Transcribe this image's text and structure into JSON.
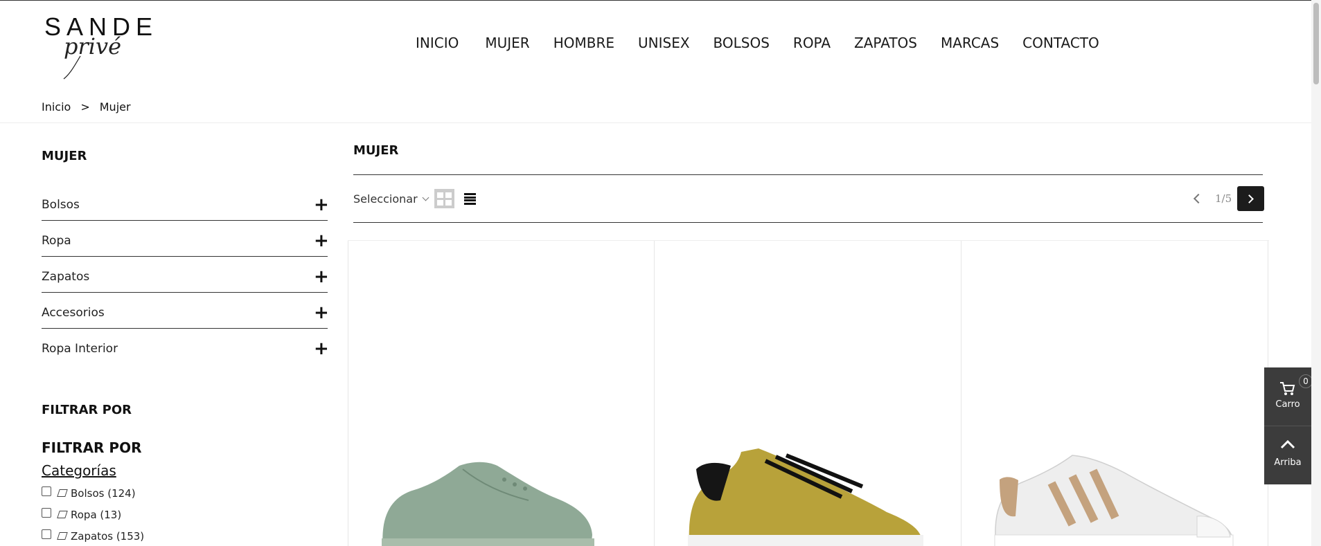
{
  "logo": {
    "word": "SANDE",
    "script": "privé"
  },
  "nav": [
    "INICIO",
    "MUJER",
    "HOMBRE",
    "UNISEX",
    "BOLSOS",
    "ROPA",
    "ZAPATOS",
    "MARCAS",
    "CONTACTO"
  ],
  "breadcrumb": {
    "home": "Inicio",
    "separator": ">",
    "current": "Mujer"
  },
  "sidebar": {
    "title": "MUJER",
    "categories": [
      "Bolsos",
      "Ropa",
      "Zapatos",
      "Accesorios",
      "Ropa Interior"
    ],
    "expand_icon": "plus-icon",
    "filter_heading": "FILTRAR POR",
    "filter_heading_2": "FILTRAR POR",
    "filter_group_title": "Categorías",
    "filter_options": [
      {
        "label": "Bolsos (124)",
        "checked": false
      },
      {
        "label": "Ropa (13)",
        "checked": false
      },
      {
        "label": "Zapatos (153)",
        "checked": false
      }
    ]
  },
  "main": {
    "title": "MUJER",
    "sort_label": "Seleccionar",
    "view_grid_icon": "grid-view-icon",
    "view_list_icon": "list-view-icon",
    "pagination": "1/5",
    "products": [
      {
        "image": "green-sneaker",
        "color": "#8fa996"
      },
      {
        "image": "gold-sneaker",
        "color": "#b8a23a"
      },
      {
        "image": "white-striped-sneaker",
        "color": "#e8e8e8"
      }
    ]
  },
  "float": {
    "cart_label": "Carro",
    "cart_count": "0",
    "top_label": "Arriba"
  },
  "colors": {
    "dark_panel": "#3c3c3c",
    "pager_active": "#1c1c1c"
  }
}
